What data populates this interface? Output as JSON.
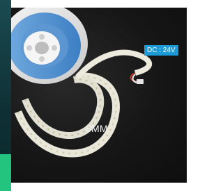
{
  "product": {
    "voltage_badge": "DC : 24V",
    "width_label": "8MM"
  },
  "colors": {
    "badge_bg": "#1d9bd8",
    "background": "#161616",
    "edge_green": "#22c47e"
  }
}
